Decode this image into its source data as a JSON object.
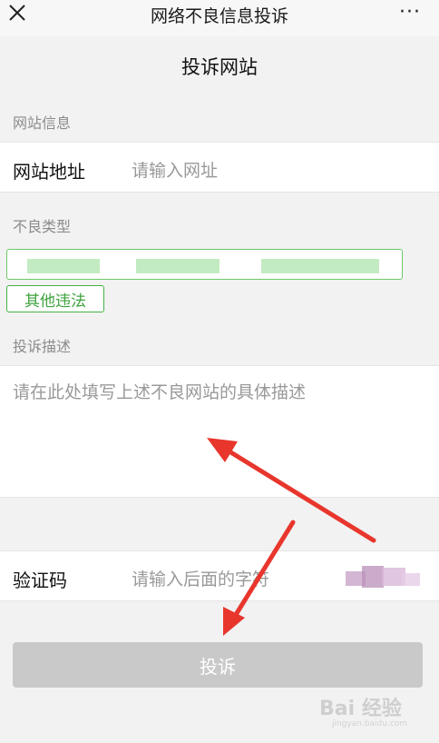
{
  "topbar": {
    "title": "网络不良信息投诉",
    "close_icon": "close-icon",
    "more_label": "···"
  },
  "page": {
    "heading": "投诉网站"
  },
  "site_info": {
    "section_label": "网站信息",
    "url_label": "网站地址",
    "url_placeholder": "请输入网址"
  },
  "bad_type": {
    "section_label": "不良类型",
    "selected_option": "其他违法"
  },
  "description": {
    "section_label": "投诉描述",
    "placeholder": "请在此处填写上述不良网站的具体描述"
  },
  "captcha": {
    "label": "验证码",
    "placeholder": "请输入后面的字符"
  },
  "submit": {
    "label": "投诉"
  },
  "watermark": {
    "logo": "Bai 经验",
    "sub": "jingyan.baidu.com"
  },
  "colors": {
    "accent": "#3fa33f",
    "arrow": "#e8362d",
    "button_disabled": "#c9c9c9"
  }
}
